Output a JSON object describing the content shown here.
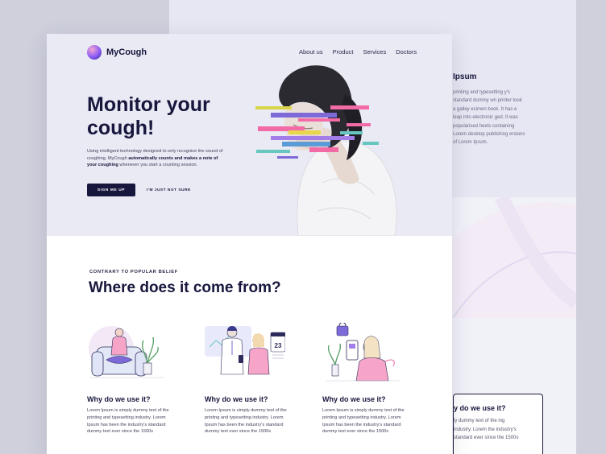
{
  "back_page": {
    "heading": "Ipsum",
    "paragraph": "printing and typesetting y's standard dummy wn printer took a galley ecimen book. It has e leap into electronic ged. It was popularised heets containing Lorem desktop publishing ersions of Lorem Ipsum.",
    "card_title": "y do we use it?",
    "card_text": "ly dummy text of the ing industry. Lorem the industry's standard ever since the 1500s"
  },
  "brand": {
    "name": "MyCough"
  },
  "nav": [
    "About us",
    "Product",
    "Services",
    "Doctors"
  ],
  "hero": {
    "title": "Monitor your cough!",
    "text_pre": "Using intelligent technology designed to only recognize the sound of coughing, MyCough ",
    "text_bold": "automatically counts and makes a note of your coughing",
    "text_post": " whenever you start a counting session.",
    "primary_cta": "SIGN ME UP",
    "secondary_cta": "I'M JUST NOT SURE"
  },
  "section": {
    "eyebrow": "CONTRARY TO POPULAR BELIEF",
    "title": "Where does it come from?",
    "features": [
      {
        "title": "Why do we use it?",
        "text": "Lorem Ipsum is simply dummy text of the printing and typesetting industry. Lorem Ipsum has been the industry's standard dummy text ever since the 1500s",
        "icon": "person-on-armchair-illustration"
      },
      {
        "title": "Why do we use it?",
        "text": "Lorem Ipsum is simply dummy text of the printing and typesetting industry. Lorem Ipsum has been the industry's standard dummy text ever since the 1500s",
        "icon": "doctor-consultation-illustration",
        "calendar_number": "23"
      },
      {
        "title": "Why do we use it?",
        "text": "Lorem Ipsum is simply dummy text of the printing and typesetting industry. Lorem Ipsum has been the industry's standard dummy text ever since the 1500s",
        "icon": "phone-privacy-illustration"
      }
    ]
  },
  "colors": {
    "navy": "#17163d",
    "hero_bg": "#e9eaf4",
    "accent_pink": "#f06eaa",
    "accent_purple": "#8b5cf6"
  }
}
